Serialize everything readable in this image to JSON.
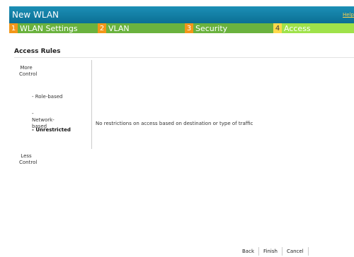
{
  "window": {
    "title": "New WLAN",
    "help_label": "Help"
  },
  "tabs": [
    {
      "num": "1",
      "label": "WLAN Settings",
      "active": false
    },
    {
      "num": "2",
      "label": "VLAN",
      "active": false
    },
    {
      "num": "3",
      "label": "Security",
      "active": false
    },
    {
      "num": "4",
      "label": "Access",
      "active": true
    }
  ],
  "access_rules": {
    "title": "Access Rules",
    "more_control": "More Control",
    "less_control": "Less Control",
    "options": [
      {
        "label": "- Role-based",
        "selected": false
      },
      {
        "label": "- Network-based",
        "selected": false
      },
      {
        "label": "- Unrestricted",
        "selected": true
      }
    ],
    "description": "No restrictions on access based on destination or type of traffic"
  },
  "footer": {
    "back": "Back",
    "finish": "Finish",
    "cancel": "Cancel"
  },
  "colors": {
    "title_bar": "#0b6f94",
    "tab_green": "#6ab23e",
    "tab_active": "#9fe24a",
    "step_orange": "#f29619",
    "step_active": "#ffd94a"
  }
}
